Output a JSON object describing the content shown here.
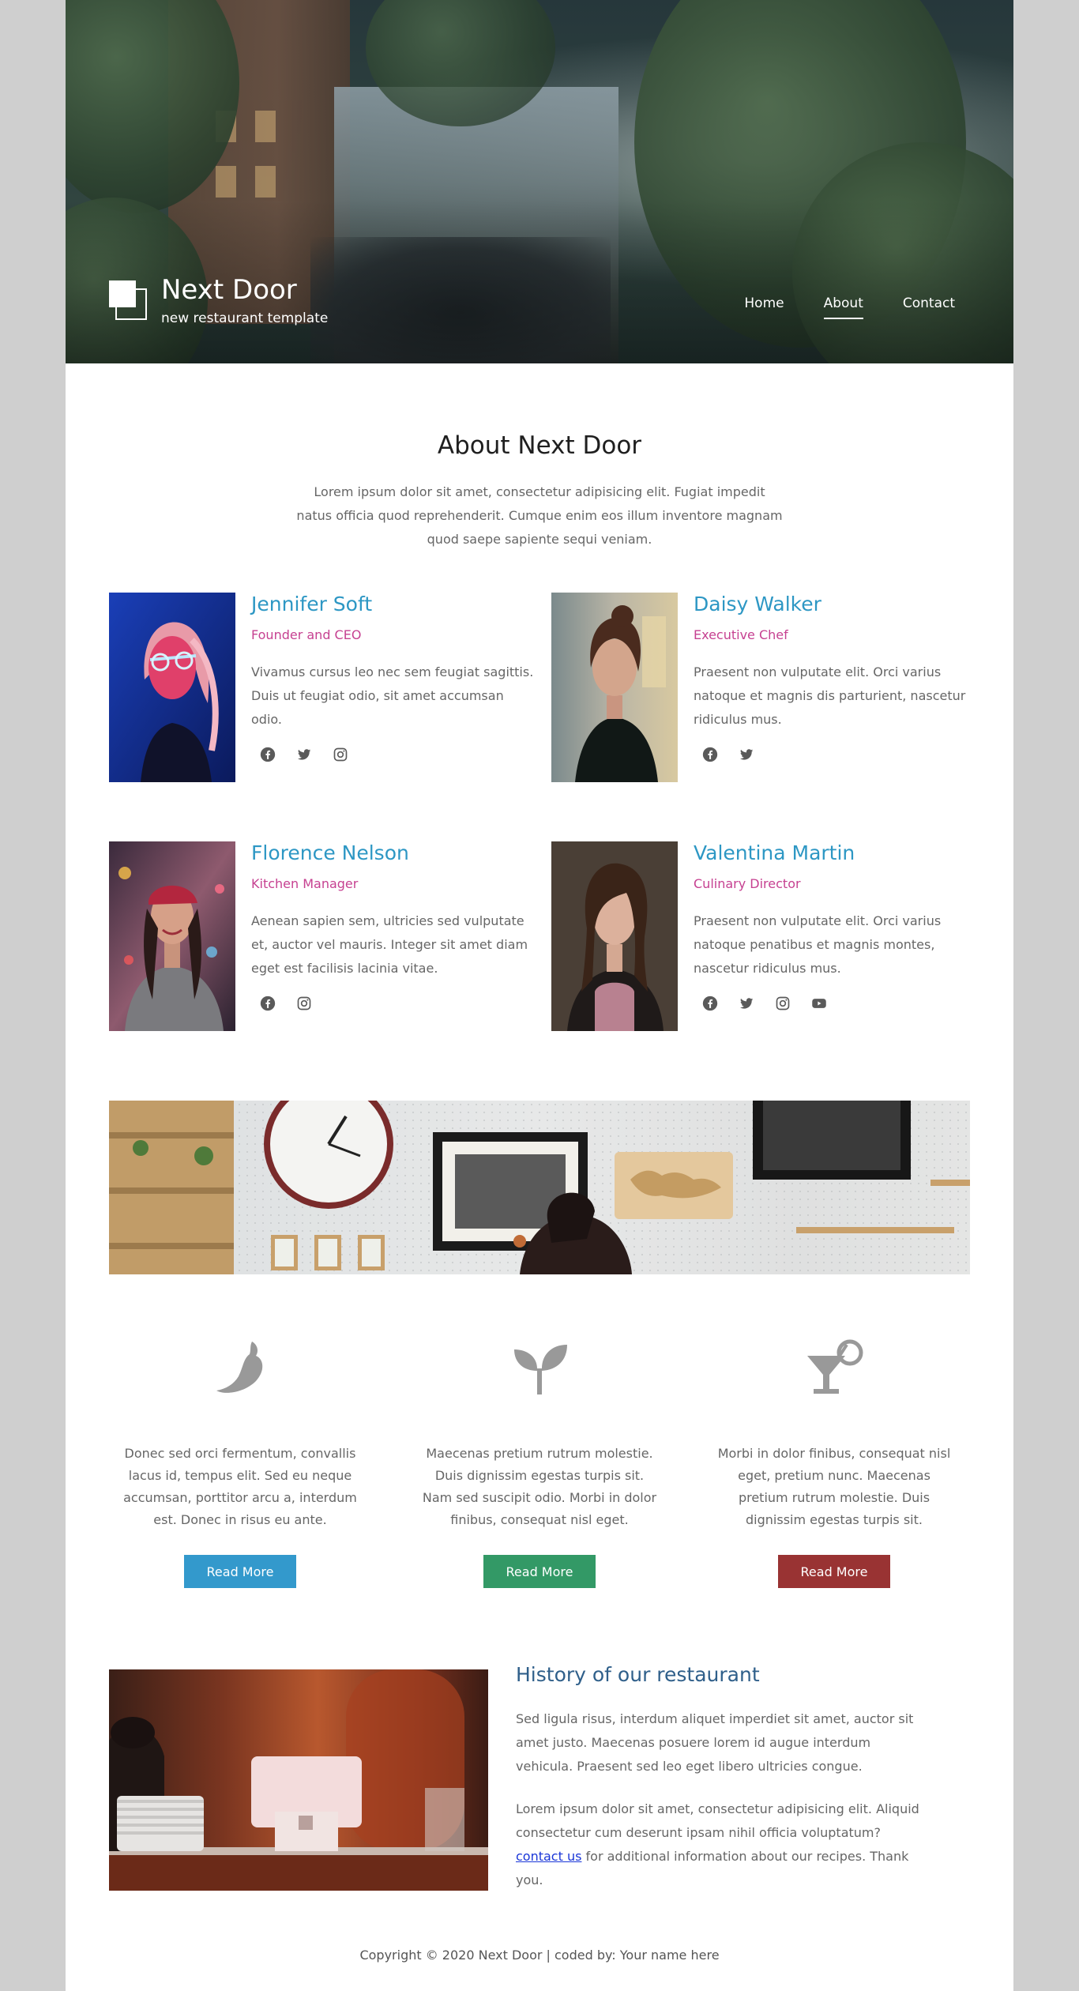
{
  "brand": {
    "title": "Next Door",
    "tagline": "new restaurant template"
  },
  "nav": {
    "items": [
      {
        "label": "Home",
        "active": false
      },
      {
        "label": "About",
        "active": true
      },
      {
        "label": "Contact",
        "active": false
      }
    ]
  },
  "about": {
    "title": "About Next Door",
    "text": "Lorem ipsum dolor sit amet, consectetur adipisicing elit. Fugiat impedit natus officia quod reprehenderit. Cumque enim eos illum inventore magnam quod saepe sapiente sequi veniam."
  },
  "team": [
    {
      "name": "Jennifer Soft",
      "role": "Founder and CEO",
      "desc": "Vivamus cursus leo nec sem feugiat sagittis. Duis ut feugiat odio, sit amet accumsan odio.",
      "social": [
        "facebook-icon",
        "twitter-icon",
        "instagram-icon"
      ]
    },
    {
      "name": "Daisy Walker",
      "role": "Executive Chef",
      "desc": "Praesent non vulputate elit. Orci varius natoque et magnis dis parturient, nascetur ridiculus mus.",
      "social": [
        "facebook-icon",
        "twitter-icon"
      ]
    },
    {
      "name": "Florence Nelson",
      "role": "Kitchen Manager",
      "desc": "Aenean sapien sem, ultricies sed vulputate et, auctor vel mauris. Integer sit amet diam eget est facilisis lacinia vitae.",
      "social": [
        "facebook-icon",
        "instagram-icon"
      ]
    },
    {
      "name": "Valentina Martin",
      "role": "Culinary Director",
      "desc": "Praesent non vulputate elit. Orci varius natoque penatibus et magnis montes, nascetur ridiculus mus.",
      "social": [
        "facebook-icon",
        "twitter-icon",
        "instagram-icon",
        "youtube-icon"
      ]
    }
  ],
  "features": [
    {
      "icon": "chili-pepper-icon",
      "text": "Donec sed orci fermentum, convallis lacus id, tempus elit. Sed eu neque accumsan, porttitor arcu a, interdum est. Donec in risus eu ante.",
      "button": "Read More",
      "color": "#3399cc"
    },
    {
      "icon": "sprout-icon",
      "text": "Maecenas pretium rutrum molestie. Duis dignissim egestas turpis sit. Nam sed suscipit odio. Morbi in dolor finibus, consequat nisl eget.",
      "button": "Read More",
      "color": "#339966"
    },
    {
      "icon": "cocktail-icon",
      "text": "Morbi in dolor finibus, consequat nisl eget, pretium nunc. Maecenas pretium rutrum molestie. Duis dignissim egestas turpis sit.",
      "button": "Read More",
      "color": "#993333"
    }
  ],
  "history": {
    "title": "History of our restaurant",
    "p1": "Sed ligula risus, interdum aliquet imperdiet sit amet, auctor sit amet justo. Maecenas posuere lorem id augue interdum vehicula. Praesent sed leo eget libero ultricies congue.",
    "p2_before": "Lorem ipsum dolor sit amet, consectetur adipisicing elit. Aliquid consectetur cum deserunt ipsam nihil officia voluptatum?",
    "p2_link": "contact us",
    "p2_after": "for additional information about our recipes. Thank you."
  },
  "footer": {
    "text": "Copyright © 2020 Next Door | coded by: Your name here"
  },
  "colors": {
    "accent_blue": "#2d97c4",
    "accent_pink": "#c64191",
    "history_title": "#2f5f8a"
  }
}
